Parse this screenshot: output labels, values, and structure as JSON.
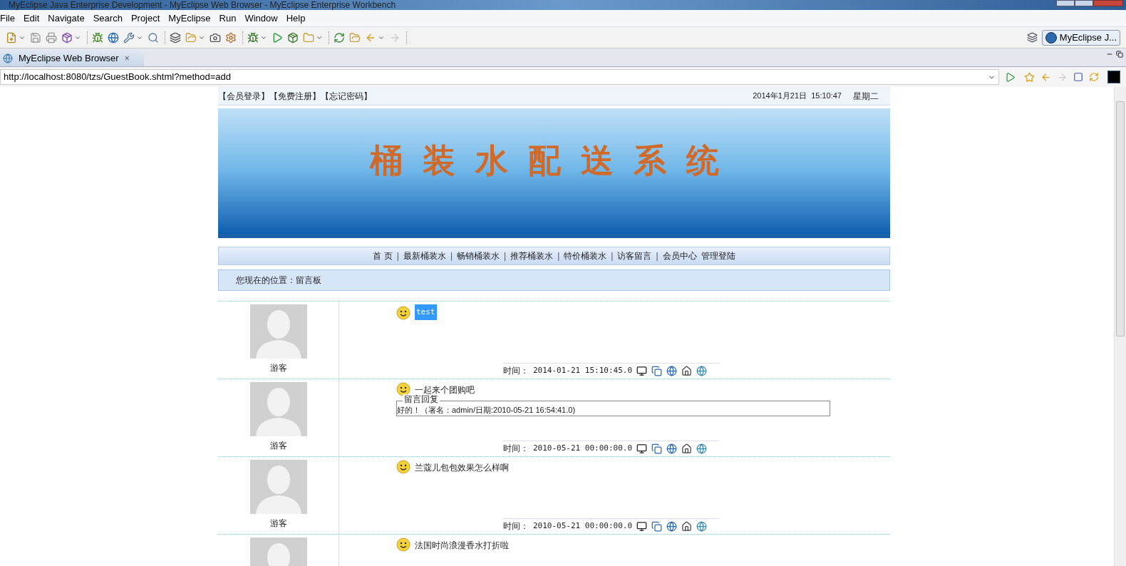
{
  "window": {
    "title": "MyEclipse Java Enterprise Development - MyEclipse Web Browser - MyEclipse Enterprise Workbench"
  },
  "menu": [
    "File",
    "Edit",
    "Navigate",
    "Search",
    "Project",
    "MyEclipse",
    "Run",
    "Window",
    "Help"
  ],
  "perspective": {
    "label": "MyEclipse J..."
  },
  "tab": {
    "label": "MyEclipse Web Browser",
    "close": "×"
  },
  "url": {
    "value": "http://localhost:8080/tzs/GuestBook.shtml?method=add"
  },
  "page": {
    "top_links": [
      "【会员登录】",
      "【免费注册】",
      "【忘记密码】"
    ],
    "datetime": "2014年1月21日  15:10:47",
    "weekday": "星期二",
    "banner_title": "桶装水配送系统",
    "nav": [
      {
        "label": "首 页"
      },
      {
        "separator": "|",
        "label": "最新桶装水"
      },
      {
        "separator": "|",
        "label": "畅销桶装水"
      },
      {
        "separator": "|",
        "label": "推荐桶装水"
      },
      {
        "separator": "|",
        "label": "特价桶装水"
      },
      {
        "separator": "|",
        "label": "访客留言"
      },
      {
        "separator": "|",
        "label": "会员中心"
      },
      {
        "label": "管理登陆"
      }
    ],
    "location": "您现在的位置：留言板",
    "posts": [
      {
        "author": "游客",
        "message": "test",
        "selected": true,
        "time_label": "时间：",
        "time": "2014-01-21 15:10:45.0"
      },
      {
        "author": "游客",
        "message": "一起来个团购吧",
        "selected": false,
        "reply": {
          "legend": "留言回复",
          "text": "好的！（署名：admin/日期:2010-05-21 16:54:41.0)"
        },
        "time_label": "时间：",
        "time": "2010-05-21 00:00:00.0"
      },
      {
        "author": "游客",
        "message": "兰蔻儿包包效果怎么样啊",
        "selected": false,
        "time_label": "时间：",
        "time": "2010-05-21 00:00:00.0"
      },
      {
        "message": "法国时尚浪漫香水打折啦",
        "selected": false
      }
    ]
  }
}
